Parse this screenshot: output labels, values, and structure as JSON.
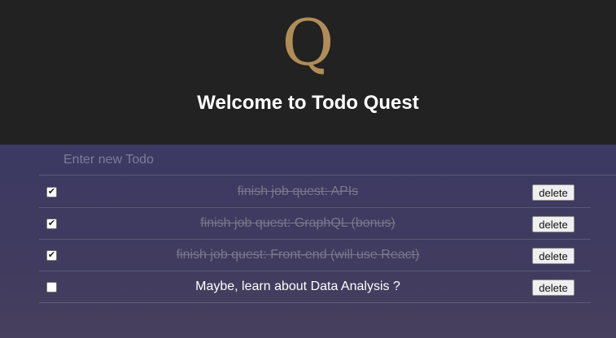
{
  "header": {
    "logo_letter": "Q",
    "title": "Welcome to Todo Quest"
  },
  "new_todo": {
    "placeholder": "Enter new Todo",
    "value": ""
  },
  "todos": [
    {
      "text": "finish job quest: APIs",
      "completed": true,
      "delete_label": "delete"
    },
    {
      "text": "finish job quest: GraphQL (bonus)",
      "completed": true,
      "delete_label": "delete"
    },
    {
      "text": "finish job quest: Front-end (will use React)",
      "completed": true,
      "delete_label": "delete"
    },
    {
      "text": "Maybe, learn about Data Analysis ?",
      "completed": false,
      "delete_label": "delete"
    }
  ],
  "colors": {
    "header_bg": "#222222",
    "logo": "#b08d57",
    "body_bg": "#3c3a62",
    "completed_text": "#79788c"
  }
}
